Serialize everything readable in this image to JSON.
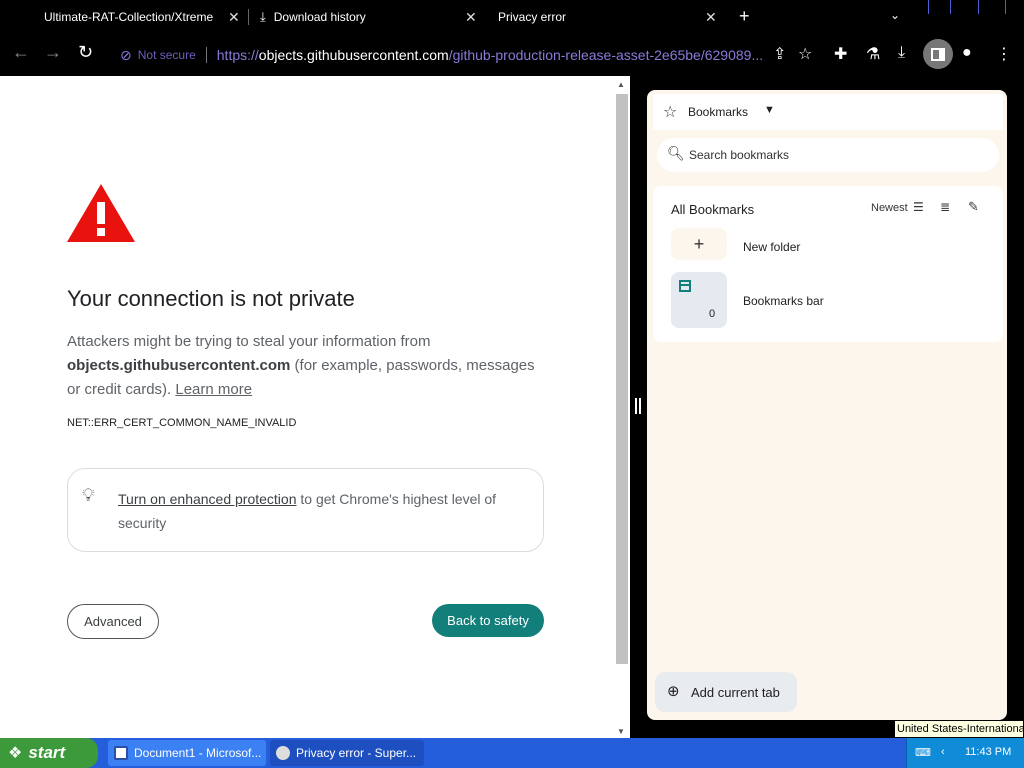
{
  "tabs": [
    {
      "title": "Ultimate-RAT-Collection/XtremeR",
      "close": "✕"
    },
    {
      "title": "Download history",
      "close": "✕"
    },
    {
      "title": "Privacy error",
      "close": "✕"
    }
  ],
  "toolbar": {
    "back": "←",
    "forward": "→",
    "reload": "↻",
    "security_label": "Not secure",
    "url_scheme": "https://",
    "url_host": "objects.githubusercontent.com",
    "url_path": "/github-production-release-asset-2e65be/629089..."
  },
  "page": {
    "headline": "Your connection is not private",
    "msg_before": "Attackers might be trying to steal your information from ",
    "msg_host": "objects.githubusercontent.com",
    "msg_after": " (for example, passwords, messages or credit cards). ",
    "learn_more": "Learn more",
    "error_code": "NET::ERR_CERT_COMMON_NAME_INVALID",
    "enhanced_link": "Turn on enhanced protection",
    "enhanced_rest": " to get Chrome's highest level of security",
    "advanced_button": "Advanced",
    "safety_button": "Back to safety"
  },
  "side_panel": {
    "title": "Bookmarks",
    "search_placeholder": "Search bookmarks",
    "section_title": "All Bookmarks",
    "sort_label": "Newest",
    "new_folder_label": "New folder",
    "bookmarks_bar_label": "Bookmarks bar",
    "bookmarks_bar_count": "0",
    "add_current_tab": "Add current tab"
  },
  "tooltip": "United States-International",
  "taskbar": {
    "start_label": "start",
    "tasks": [
      {
        "label": "Document1 - Microsof..."
      },
      {
        "label": "Privacy error - Super..."
      }
    ],
    "clock": "11:43 PM"
  },
  "colors": {
    "accent_teal": "#137f7a",
    "warning_red": "#e8120f",
    "taskbar_blue": "#245edb",
    "start_green": "#3c9a3b"
  }
}
